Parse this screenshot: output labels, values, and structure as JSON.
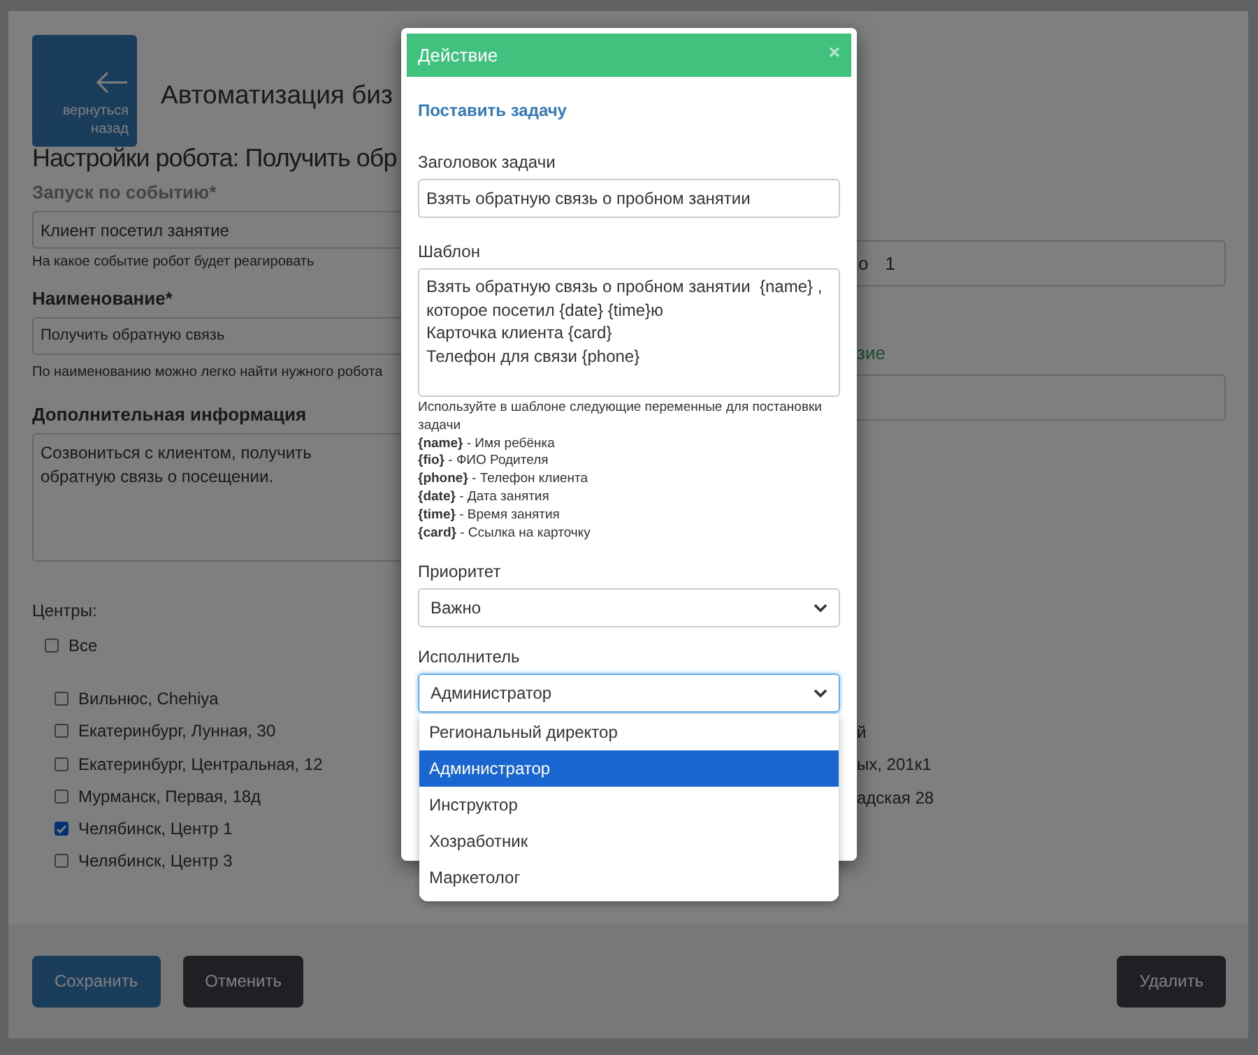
{
  "page": {
    "back_button": {
      "label": "вернуться назад"
    },
    "title": "Автоматизация биз",
    "subtitle": "Настройки робота: Получить обр",
    "event": {
      "label": "Запуск по событию*",
      "value": "Клиент посетил занятие",
      "hint": "На какое событие робот будет реагировать"
    },
    "name": {
      "label": "Наименование*",
      "value": "Получить обратную связь",
      "hint": "По наименованию можно легко найти нужного робота"
    },
    "info": {
      "label": "Дополнительная информация",
      "value": "Созвониться с клиентом, получить обратную связь о посещении."
    },
    "centers": {
      "label": "Центры:",
      "all": {
        "label": "Все",
        "checked": false
      },
      "items": [
        {
          "label": "Вильнюс, Chehiya",
          "checked": false
        },
        {
          "label": "Екатеринбург, Лунная, 30",
          "checked": false
        },
        {
          "label": "Екатеринбург, Центральная, 12",
          "checked": false
        },
        {
          "label": "Мурманск, Первая, 18д",
          "checked": false
        },
        {
          "label": "Челябинск, Центр 1",
          "checked": true
        },
        {
          "label": "Челябинск, Центр 3",
          "checked": false
        }
      ]
    },
    "right_column": {
      "field_label_end": "о",
      "field_value": "1",
      "action_label_end": "зие",
      "center_fragments": [
        "й",
        "ых, 201к1",
        "адская 28"
      ]
    },
    "footer": {
      "save": "Сохранить",
      "cancel": "Отменить",
      "delete": "Удалить"
    }
  },
  "modal": {
    "title": "Действие",
    "close": "×",
    "heading": "Поставить задачу",
    "task_title": {
      "label": "Заголовок задачи",
      "value": "Взять обратную связь о пробном занятии"
    },
    "template": {
      "label": "Шаблон",
      "lines": [
        "Взять обратную связь о пробном занятии  {name} ,",
        "которое посетил {date} {time}ю",
        "Карточка клиента {card}",
        "Телефон для связи {phone}"
      ]
    },
    "help": {
      "intro": "Используйте в шаблоне следующие переменные для постановки задачи",
      "variables": [
        "**{name}** - Имя ребёнка",
        "**{fio}** - ФИО Родителя",
        "**{phone}** - Телефон клиента",
        "**{date}** - Дата занятия",
        "**{time}** - Время занятия",
        "**{card}** - Ссылка на карточку"
      ]
    },
    "priority": {
      "label": "Приоритет",
      "value": "Важно"
    },
    "assignee": {
      "label": "Исполнитель",
      "value": "Администратор",
      "options": [
        {
          "label": "Региональный директор",
          "selected": false
        },
        {
          "label": "Администратор",
          "selected": true
        },
        {
          "label": "Инструктор",
          "selected": false
        },
        {
          "label": "Хозработник",
          "selected": false
        },
        {
          "label": "Маркетолог",
          "selected": false
        }
      ]
    }
  }
}
